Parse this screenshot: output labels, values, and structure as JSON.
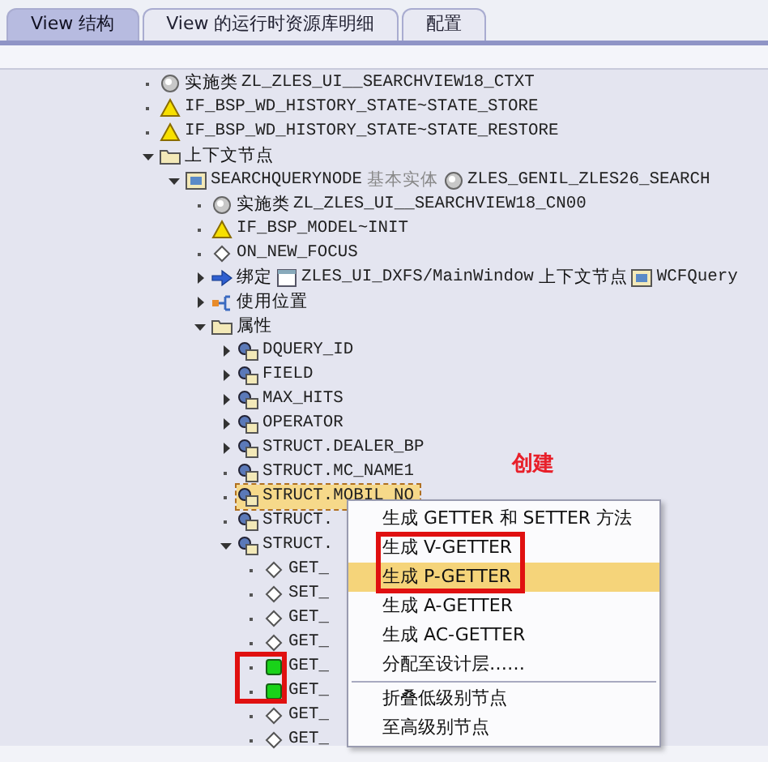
{
  "tabs": [
    {
      "label": "View 结构",
      "selected": true
    },
    {
      "label": "View 的运行时资源库明细",
      "selected": false
    },
    {
      "label": "配置",
      "selected": false
    }
  ],
  "tree": [
    {
      "expandable": false,
      "expanded": false,
      "kind": "circle",
      "selected": false,
      "segments": [
        {
          "kind": "label",
          "text": "实施类"
        },
        {
          "kind": "code",
          "text": "ZL_ZLES_UI__SEARCHVIEW18_CTXT"
        }
      ]
    },
    {
      "expandable": false,
      "expanded": false,
      "kind": "warning",
      "selected": false,
      "segments": [
        {
          "kind": "code",
          "text": "IF_BSP_WD_HISTORY_STATE~STATE_STORE"
        }
      ]
    },
    {
      "expandable": false,
      "expanded": false,
      "kind": "warning",
      "selected": false,
      "segments": [
        {
          "kind": "code",
          "text": "IF_BSP_WD_HISTORY_STATE~STATE_RESTORE"
        }
      ]
    },
    {
      "expandable": true,
      "expanded": true,
      "kind": "folder",
      "selected": false,
      "segments": [
        {
          "kind": "label",
          "text": "上下文节点"
        }
      ],
      "children": [
        {
          "expandable": true,
          "expanded": true,
          "kind": "entity",
          "selected": false,
          "segments": [
            {
              "kind": "code",
              "text": "SEARCHQUERYNODE"
            },
            {
              "kind": "note",
              "text": "基本实体"
            },
            {
              "kind": "circle"
            },
            {
              "kind": "code",
              "text": "ZLES_GENIL_ZLES26_SEARCH"
            }
          ],
          "children": [
            {
              "expandable": false,
              "expanded": false,
              "kind": "circle",
              "selected": false,
              "segments": [
                {
                  "kind": "label",
                  "text": "实施类"
                },
                {
                  "kind": "code",
                  "text": "ZL_ZLES_UI__SEARCHVIEW18_CN00"
                }
              ]
            },
            {
              "expandable": false,
              "expanded": false,
              "kind": "warning",
              "selected": false,
              "segments": [
                {
                  "kind": "code",
                  "text": "IF_BSP_MODEL~INIT"
                }
              ]
            },
            {
              "expandable": false,
              "expanded": false,
              "kind": "diamond",
              "selected": false,
              "segments": [
                {
                  "kind": "code",
                  "text": "ON_NEW_FOCUS"
                }
              ]
            },
            {
              "expandable": true,
              "expanded": false,
              "kind": "arrow",
              "selected": false,
              "segments": [
                {
                  "kind": "label",
                  "text": "绑定"
                },
                {
                  "kind": "window"
                },
                {
                  "kind": "code",
                  "text": "ZLES_UI_DXFS/MainWindow"
                },
                {
                  "kind": "label",
                  "text": "上下文节点"
                },
                {
                  "kind": "entity"
                },
                {
                  "kind": "code",
                  "text": "WCFQuery"
                }
              ]
            },
            {
              "expandable": true,
              "expanded": false,
              "kind": "usage",
              "selected": false,
              "segments": [
                {
                  "kind": "label",
                  "text": "使用位置"
                }
              ]
            },
            {
              "expandable": true,
              "expanded": true,
              "kind": "folder",
              "selected": false,
              "segments": [
                {
                  "kind": "label",
                  "text": "属性"
                }
              ],
              "children": [
                {
                  "expandable": true,
                  "expanded": false,
                  "kind": "attribute",
                  "selected": false,
                  "segments": [
                    {
                      "kind": "code",
                      "text": "DQUERY_ID"
                    }
                  ]
                },
                {
                  "expandable": true,
                  "expanded": false,
                  "kind": "attribute",
                  "selected": false,
                  "segments": [
                    {
                      "kind": "code",
                      "text": "FIELD"
                    }
                  ]
                },
                {
                  "expandable": true,
                  "expanded": false,
                  "kind": "attribute",
                  "selected": false,
                  "segments": [
                    {
                      "kind": "code",
                      "text": "MAX_HITS"
                    }
                  ]
                },
                {
                  "expandable": true,
                  "expanded": false,
                  "kind": "attribute",
                  "selected": false,
                  "segments": [
                    {
                      "kind": "code",
                      "text": "OPERATOR"
                    }
                  ]
                },
                {
                  "expandable": true,
                  "expanded": false,
                  "kind": "attribute",
                  "selected": false,
                  "segments": [
                    {
                      "kind": "code",
                      "text": "STRUCT.DEALER_BP"
                    }
                  ]
                },
                {
                  "expandable": false,
                  "expanded": false,
                  "kind": "attribute",
                  "selected": false,
                  "segments": [
                    {
                      "kind": "code",
                      "text": "STRUCT.MC_NAME1"
                    }
                  ]
                },
                {
                  "expandable": false,
                  "expanded": false,
                  "kind": "attribute",
                  "selected": true,
                  "segments": [
                    {
                      "kind": "code",
                      "text": "STRUCT.MOBIL_NO"
                    }
                  ]
                },
                {
                  "expandable": false,
                  "expanded": false,
                  "kind": "attribute",
                  "selected": false,
                  "segments": [
                    {
                      "kind": "code",
                      "text": "STRUCT."
                    }
                  ]
                },
                {
                  "expandable": true,
                  "expanded": true,
                  "kind": "attribute",
                  "selected": false,
                  "segments": [
                    {
                      "kind": "code",
                      "text": "STRUCT."
                    }
                  ],
                  "children": [
                    {
                      "expandable": false,
                      "expanded": false,
                      "kind": "diamond",
                      "selected": false,
                      "boxed": false,
                      "segments": [
                        {
                          "kind": "code",
                          "text": "GET_"
                        }
                      ]
                    },
                    {
                      "expandable": false,
                      "expanded": false,
                      "kind": "diamond",
                      "selected": false,
                      "boxed": false,
                      "segments": [
                        {
                          "kind": "code",
                          "text": "SET_"
                        }
                      ]
                    },
                    {
                      "expandable": false,
                      "expanded": false,
                      "kind": "diamond",
                      "selected": false,
                      "boxed": false,
                      "segments": [
                        {
                          "kind": "code",
                          "text": "GET_"
                        }
                      ]
                    },
                    {
                      "expandable": false,
                      "expanded": false,
                      "kind": "diamond",
                      "selected": false,
                      "boxed": false,
                      "segments": [
                        {
                          "kind": "code",
                          "text": "GET_"
                        }
                      ]
                    },
                    {
                      "expandable": false,
                      "expanded": false,
                      "kind": "green",
                      "selected": false,
                      "boxed": true,
                      "segments": [
                        {
                          "kind": "code",
                          "text": "GET_"
                        }
                      ]
                    },
                    {
                      "expandable": false,
                      "expanded": false,
                      "kind": "green",
                      "selected": false,
                      "boxed": true,
                      "segments": [
                        {
                          "kind": "code",
                          "text": "GET_"
                        }
                      ]
                    },
                    {
                      "expandable": false,
                      "expanded": false,
                      "kind": "diamond",
                      "selected": false,
                      "boxed": false,
                      "segments": [
                        {
                          "kind": "code",
                          "text": "GET_"
                        }
                      ]
                    },
                    {
                      "expandable": false,
                      "expanded": false,
                      "kind": "diamond",
                      "selected": false,
                      "boxed": false,
                      "segments": [
                        {
                          "kind": "code",
                          "text": "GET_"
                        }
                      ]
                    }
                  ]
                }
              ]
            }
          ]
        }
      ]
    }
  ],
  "annotation": {
    "text": "创建"
  },
  "context_menu": [
    {
      "label": "生成 GETTER 和 SETTER 方法",
      "selected": false,
      "boxed": false,
      "separator_after": false
    },
    {
      "label": "生成 V-GETTER",
      "selected": false,
      "boxed": true,
      "separator_after": false
    },
    {
      "label": "生成 P-GETTER",
      "selected": true,
      "boxed": true,
      "separator_after": false
    },
    {
      "label": "生成 A-GETTER",
      "selected": false,
      "boxed": false,
      "separator_after": false
    },
    {
      "label": "生成 AC-GETTER",
      "selected": false,
      "boxed": false,
      "separator_after": false
    },
    {
      "label": "分配至设计层……",
      "selected": false,
      "boxed": false,
      "separator_after": true
    },
    {
      "label": "折叠低级别节点",
      "selected": false,
      "boxed": false,
      "separator_after": false
    },
    {
      "label": "至高级别节点",
      "selected": false,
      "boxed": false,
      "separator_after": false
    }
  ]
}
